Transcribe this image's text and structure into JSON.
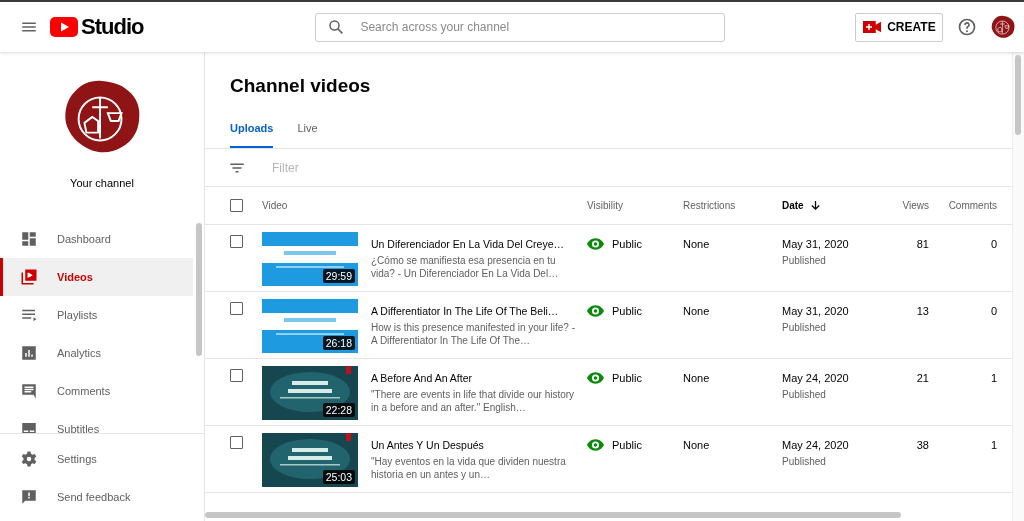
{
  "header": {
    "logo_text": "Studio",
    "search": {
      "placeholder": "Search across your channel"
    },
    "create_button": "CREATE"
  },
  "sidebar": {
    "channel_label": "Your channel",
    "items": [
      {
        "label": "Dashboard",
        "kind": "dashboard",
        "selected": false
      },
      {
        "label": "Videos",
        "kind": "videos",
        "selected": true
      },
      {
        "label": "Playlists",
        "kind": "playlists",
        "selected": false
      },
      {
        "label": "Analytics",
        "kind": "analytics",
        "selected": false
      },
      {
        "label": "Comments",
        "kind": "comments",
        "selected": false
      },
      {
        "label": "Subtitles",
        "kind": "subtitles",
        "selected": false
      }
    ],
    "footer_items": [
      {
        "label": "Settings",
        "kind": "settings"
      },
      {
        "label": "Send feedback",
        "kind": "feedback"
      }
    ]
  },
  "page_title": "Channel videos",
  "tabs": [
    {
      "label": "Uploads",
      "selected": true
    },
    {
      "label": "Live",
      "selected": false
    }
  ],
  "filter": {
    "placeholder": "Filter"
  },
  "table": {
    "select_all_checked": false,
    "columns": [
      {
        "label": "Video",
        "sorted": false
      },
      {
        "label": "Visibility",
        "sorted": false
      },
      {
        "label": "Restrictions",
        "sorted": false
      },
      {
        "label": "Date",
        "sorted": true
      },
      {
        "label": "Views",
        "sorted": false
      },
      {
        "label": "Comments",
        "sorted": false
      }
    ],
    "rows": [
      {
        "checked": false,
        "title": "Un Diferenciador En La Vida Del Creye…",
        "description": "¿Cómo se manifiesta esa presencia en tu vida? - Un Diferenciador En La Vida Del…",
        "duration": "29:59",
        "visibility": "Public",
        "restrictions": "None",
        "date": "May 31, 2020",
        "status": "Published",
        "views": "81",
        "comments": "0"
      },
      {
        "checked": false,
        "title": "A Differentiator In The Life Of The Beli…",
        "description": "How is this presence manifested in your life? - A Differentiator In The Life Of The…",
        "duration": "26:18",
        "visibility": "Public",
        "restrictions": "None",
        "date": "May 31, 2020",
        "status": "Published",
        "views": "13",
        "comments": "0"
      },
      {
        "checked": false,
        "title": "A Before And An After",
        "description": "\"There are events in life that divide our history in a before and an after.\" English…",
        "duration": "22:28",
        "visibility": "Public",
        "restrictions": "None",
        "date": "May 24, 2020",
        "status": "Published",
        "views": "21",
        "comments": "1"
      },
      {
        "checked": false,
        "title": "Un Antes Y Un Después",
        "description": "\"Hay eventos en la vida que dividen nuestra historia en un antes y un…",
        "duration": "25:03",
        "visibility": "Public",
        "restrictions": "None",
        "date": "May 24, 2020",
        "status": "Published",
        "views": "38",
        "comments": "1"
      }
    ]
  }
}
